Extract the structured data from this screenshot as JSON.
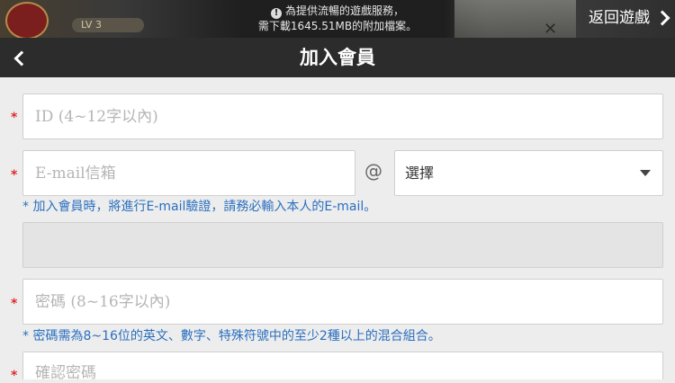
{
  "banner": {
    "notice_line1": "為提供流暢的遊戲服務，",
    "notice_line2": "需下載1645.51MB的附加檔案。",
    "level_text": "LV 3",
    "back_to_game": "返回遊戲"
  },
  "header": {
    "title": "加入會員"
  },
  "form": {
    "required_mark": "*",
    "id_placeholder": "ID (4~12字以內)",
    "email_placeholder": "E-mail信箱",
    "at_symbol": "@",
    "domain_select_value": "選擇",
    "email_hint": "* 加入會員時，將進行E-mail驗證，請務必輸入本人的E-mail。",
    "password_placeholder": "密碼 (8~16字以內)",
    "password_hint": "* 密碼需為8~16位的英文、數字、特殊符號中的至少2種以上的混合組合。",
    "confirm_password_placeholder": "確認密碼"
  },
  "icons": {
    "back": "chevron-left-icon",
    "back_to_game": "chevron-right-icon",
    "select": "caret-down-icon",
    "notice": "info-icon"
  },
  "colors": {
    "header_bg": "#2c2c2c",
    "required": "#e02a2a",
    "hint": "#2a6fbf",
    "page_bg": "#ededed"
  }
}
